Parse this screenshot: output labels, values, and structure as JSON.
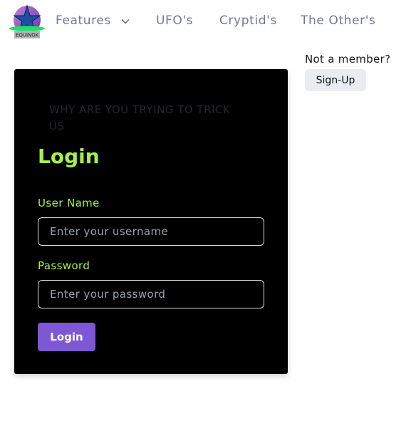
{
  "header": {
    "logo_text": "EQUINOX",
    "nav": [
      {
        "label": "Features",
        "has_dropdown": true
      },
      {
        "label": "UFO's"
      },
      {
        "label": "Cryptid's"
      },
      {
        "label": "The Other's"
      }
    ]
  },
  "membership": {
    "prompt": "Not a member?",
    "signup_label": "Sign-Up"
  },
  "login_card": {
    "warning": "WHY ARE YOU TRYING TO TRICK US",
    "title": "Login",
    "username_label": "User Name",
    "username_placeholder": "Enter your username",
    "username_value": "",
    "password_label": "Password",
    "password_placeholder": "Enter your password",
    "password_value": "",
    "submit_label": "Login"
  },
  "colors": {
    "accent_green": "#a6f04e",
    "button_purple": "#7e57d6",
    "nav_text": "#6b7a99",
    "card_bg": "#000000"
  },
  "icons": [
    "equinox-logo-icon",
    "chevron-down-icon"
  ]
}
